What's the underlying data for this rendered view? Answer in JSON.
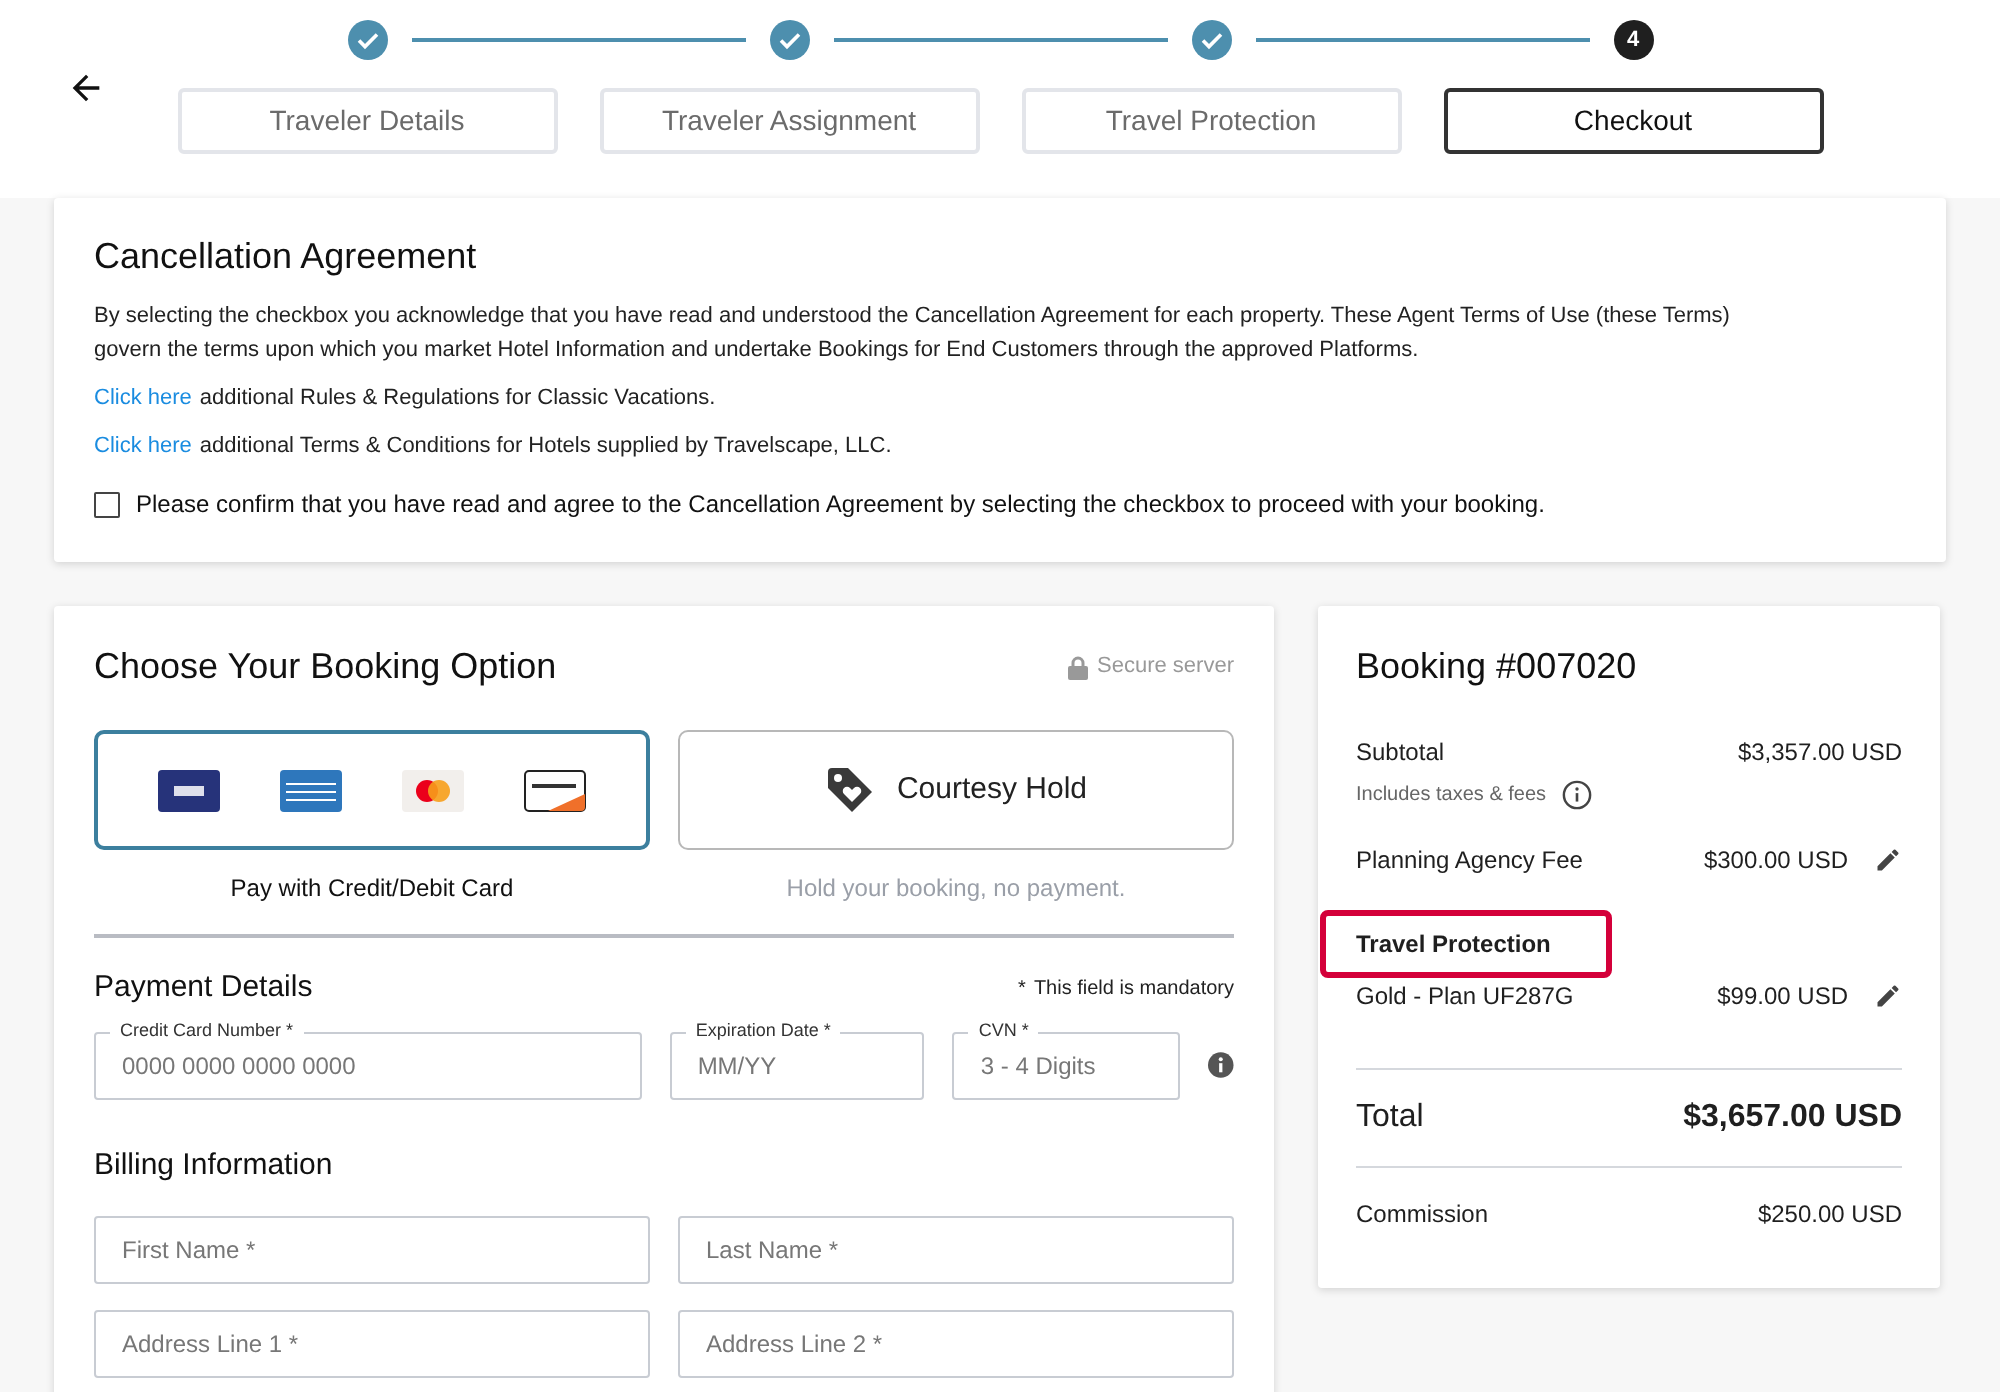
{
  "steps": [
    {
      "label": "Traveler Details",
      "done": true,
      "selected": false
    },
    {
      "label": "Traveler Assignment",
      "done": true,
      "selected": false
    },
    {
      "label": "Travel Protection",
      "done": true,
      "selected": false
    },
    {
      "label": "Checkout",
      "done": false,
      "selected": true,
      "number": "4"
    }
  ],
  "cancellation": {
    "title": "Cancellation Agreement",
    "body": "By selecting the checkbox you acknowledge that you have read and understood the Cancellation Agreement for each property. These Agent Terms of Use (these Terms) govern the terms upon which you market Hotel Information and undertake Bookings for End Customers through the approved Platforms.",
    "links": [
      {
        "link": "Click here",
        "text": "additional Rules & Regulations for Classic Vacations."
      },
      {
        "link": "Click here",
        "text": "additional Terms & Conditions for Hotels supplied by Travelscape, LLC."
      }
    ],
    "confirm": {
      "label": "Please confirm that you have read and agree to the Cancellation Agreement by selecting the checkbox to proceed with your booking.",
      "checked": false
    }
  },
  "booking_option": {
    "title": "Choose Your Booking Option",
    "secure": "Secure server",
    "options": [
      {
        "kind": "card",
        "caption": "Pay with Credit/Debit Card",
        "selected": true
      },
      {
        "kind": "hold",
        "label": "Courtesy Hold",
        "caption": "Hold your booking, no payment.",
        "selected": false
      }
    ]
  },
  "payment": {
    "title": "Payment Details",
    "mandatory_mark": "*",
    "mandatory_note": "This field is mandatory",
    "fields": [
      {
        "label": "Credit Card Number *",
        "placeholder": "0000 0000 0000 0000"
      },
      {
        "label": "Expiration Date *",
        "placeholder": "MM/YY"
      },
      {
        "label": "CVN *",
        "placeholder": "3 - 4 Digits"
      }
    ]
  },
  "billing": {
    "title": "Billing Information",
    "fields": [
      {
        "placeholder": "First Name *"
      },
      {
        "placeholder": "Last Name *"
      },
      {
        "placeholder": "Address Line 1 *"
      },
      {
        "placeholder": "Address Line 2 *"
      }
    ]
  },
  "summary": {
    "title": "Booking #007020",
    "subtotal": {
      "label": "Subtotal",
      "value": "$3,357.00 USD",
      "note": "Includes taxes & fees"
    },
    "fees": [
      {
        "label": "Planning Agency Fee",
        "value": "$300.00 USD"
      },
      {
        "heading": "Travel Protection",
        "label": "Gold - Plan UF287G",
        "value": "$99.00 USD",
        "highlighted": true
      }
    ],
    "total": {
      "label": "Total",
      "value": "$3,657.00 USD"
    },
    "commission": {
      "label": "Commission",
      "value": "$250.00 USD"
    }
  }
}
